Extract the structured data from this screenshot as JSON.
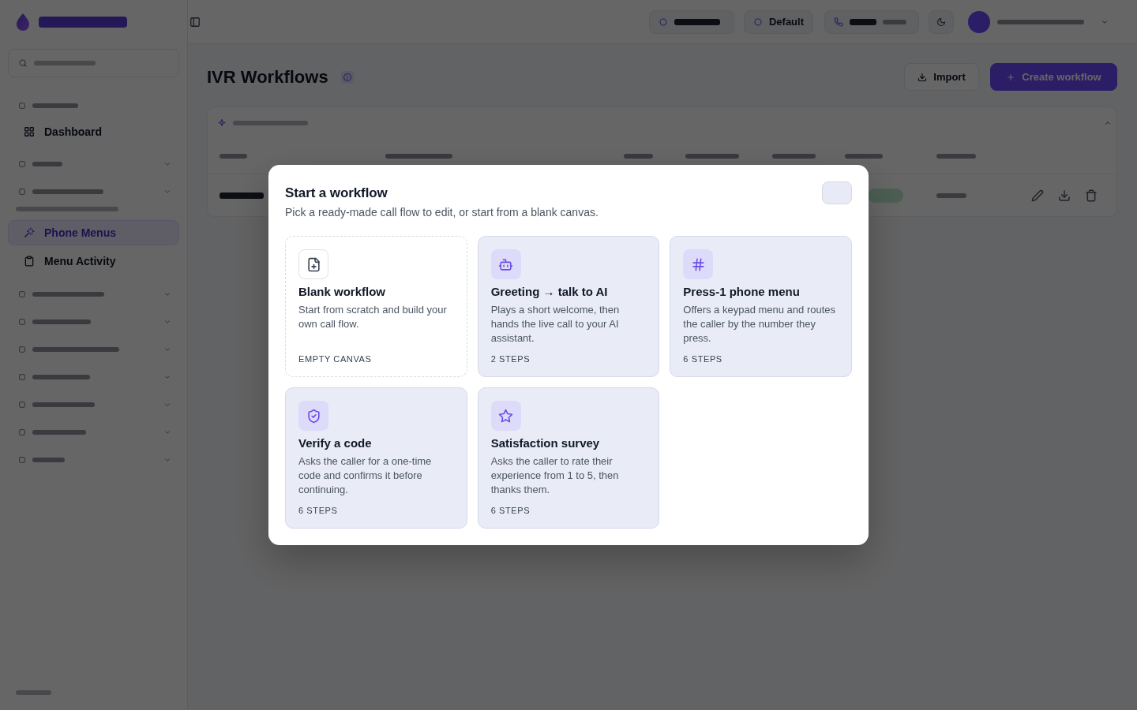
{
  "sidebar": {
    "items": [
      {
        "label": "Dashboard",
        "selected": false
      },
      {
        "label": "Phone Menus",
        "selected": true
      },
      {
        "label": "Menu Activity",
        "selected": false
      }
    ]
  },
  "top_bar": {
    "workspace": "Default"
  },
  "page": {
    "title": "IVR Workflows",
    "buttons": [
      {
        "label": "Import",
        "kind": "secondary"
      },
      {
        "label": "Create workflow",
        "kind": "primary"
      }
    ]
  },
  "modal": {
    "title": "Start a workflow",
    "subtitle": "Pick a ready-made call flow to edit, or start from a blank canvas.",
    "templates": [
      {
        "kind": "blank",
        "title": "Blank workflow",
        "description": "Start from scratch and build your own call flow.",
        "meta": "EMPTY CANVAS"
      },
      {
        "kind": "assistant",
        "title": "Greeting → talk to AI",
        "description": "Plays a short welcome, then hands the live call to your AI assistant.",
        "meta": "2 STEPS"
      },
      {
        "kind": "keypad",
        "title": "Press-1 phone menu",
        "description": "Offers a keypad menu and routes the caller by the number they press.",
        "meta": "6 STEPS"
      },
      {
        "kind": "verification",
        "title": "Verify a code",
        "description": "Asks the caller for a one-time code and confirms it before continuing.",
        "meta": "6 STEPS"
      },
      {
        "kind": "survey",
        "title": "Satisfaction survey",
        "description": "Asks the caller to rate their experience from 1 to 5, then thanks them.",
        "meta": "6 STEPS"
      }
    ]
  }
}
